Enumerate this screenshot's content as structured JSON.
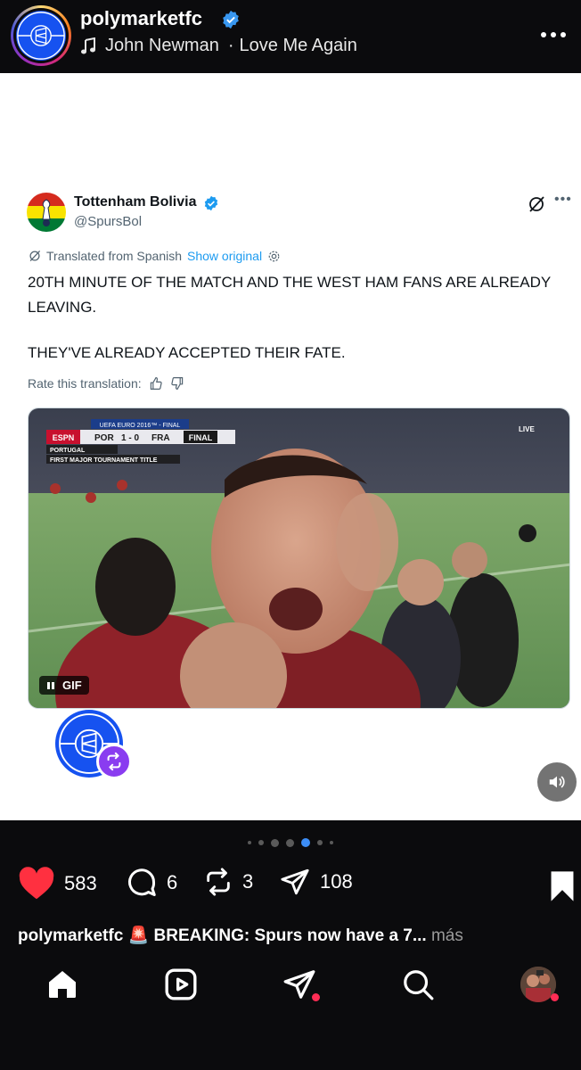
{
  "header": {
    "username": "polymarketfc",
    "song_artist": "John Newman",
    "song_separator": "·",
    "song_title": "Love Me Again",
    "more_icon": "more-dots-icon"
  },
  "tweet": {
    "name": "Tottenham Bolivia",
    "handle": "@SpursBol",
    "translated_label": "Translated from Spanish",
    "show_original": "Show original",
    "text_line1": "20TH MINUTE OF THE MATCH AND THE WEST HAM FANS ARE ALREADY LEAVING.",
    "text_line2": "THEY'VE ALREADY ACCEPTED THEIR FATE.",
    "rate_label": "Rate this translation:",
    "media": {
      "gif_label": "GIF",
      "scorebug_top": "UEFA EURO 2016™ - FINAL",
      "network": "ESPN",
      "team1": "POR",
      "score": "1 - 0",
      "team2": "FRA",
      "status": "FINAL",
      "line1": "PORTUGAL",
      "line2": "FIRST MAJOR TOURNAMENT TITLE",
      "live": "LIVE"
    }
  },
  "pager": {
    "count": 7,
    "active_index": 4
  },
  "actions": {
    "likes": "583",
    "comments": "6",
    "reposts": "3",
    "shares": "108"
  },
  "caption": {
    "username": "polymarketfc",
    "emoji": "🚨",
    "text": "BREAKING: Spurs now have a 7...",
    "more": "más"
  },
  "colors": {
    "like_red": "#ff3040",
    "polymarket_blue": "#1652f0",
    "x_blue": "#1d9bf0",
    "repost_purple": "#8a3cf0"
  }
}
